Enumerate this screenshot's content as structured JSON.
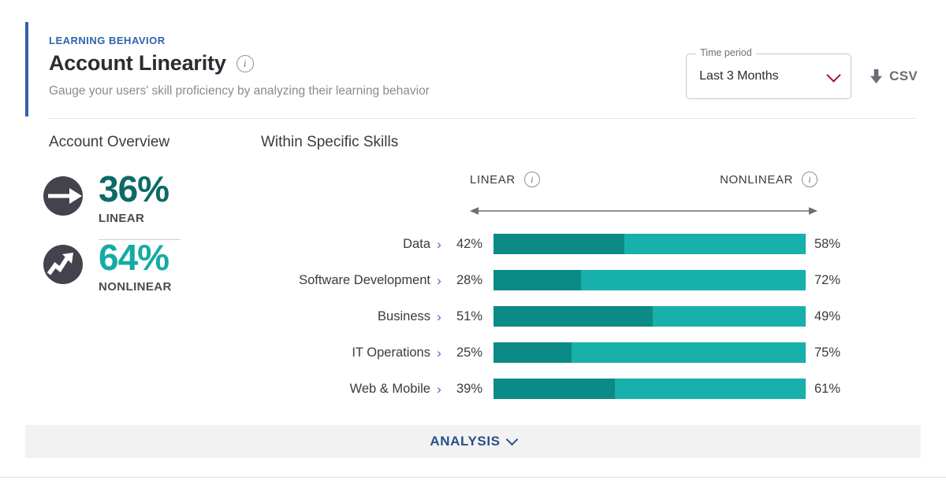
{
  "header": {
    "eyebrow": "LEARNING BEHAVIOR",
    "title": "Account Linearity",
    "subtitle": "Gauge your users' skill proficiency by analyzing their learning behavior",
    "title_info_icon": "info-icon"
  },
  "controls": {
    "time_period_legend": "Time period",
    "time_period_value": "Last 3 Months",
    "dropdown_icon": "chevron-down-icon",
    "csv_label": "CSV",
    "csv_icon": "download-arrow-icon"
  },
  "sections": {
    "account_overview": "Account Overview",
    "within_specific_skills": "Within Specific Skills"
  },
  "overview": {
    "stats": [
      {
        "value": "36%",
        "label": "LINEAR",
        "icon": "straight-arrow-icon"
      },
      {
        "value": "64%",
        "label": "NONLINEAR",
        "icon": "zigzag-arrow-icon"
      }
    ]
  },
  "axis": {
    "left_label": "LINEAR",
    "right_label": "NONLINEAR",
    "left_info_icon": "info-icon",
    "right_info_icon": "info-icon",
    "arrow_icon": "double-headed-arrow-icon"
  },
  "footer": {
    "label": "ANALYSIS",
    "icon": "chevron-down-icon"
  },
  "colors": {
    "accent_blue": "#2f63ad",
    "linear_teal": "#0c8a86",
    "nonlinear_teal": "#18b0ab",
    "stat_linear": "#0d6b66",
    "stat_nonlinear": "#15aaa5",
    "icon_circle": "#43434d",
    "dropdown_chevron": "#9b1b2e",
    "footer_blue": "#274f8d"
  },
  "chart_data": {
    "type": "bar",
    "subtype": "stacked-horizontal-100pct",
    "title": "Within Specific Skills",
    "categories": [
      "Data",
      "Software Development",
      "Business",
      "IT Operations",
      "Web & Mobile"
    ],
    "series": [
      {
        "name": "LINEAR",
        "values": [
          42,
          28,
          51,
          25,
          39
        ],
        "color": "#0c8a86"
      },
      {
        "name": "NONLINEAR",
        "values": [
          58,
          72,
          49,
          75,
          61
        ],
        "color": "#18b0ab"
      }
    ],
    "value_labels_left": [
      "42%",
      "28%",
      "51%",
      "25%",
      "39%"
    ],
    "value_labels_right": [
      "58%",
      "72%",
      "49%",
      "75%",
      "61%"
    ],
    "xlabel": "",
    "ylabel": "",
    "xlim": [
      0,
      100
    ],
    "grid": false,
    "legend": "axis-endpoints",
    "row_expand_icon": "chevron-right-icon"
  }
}
